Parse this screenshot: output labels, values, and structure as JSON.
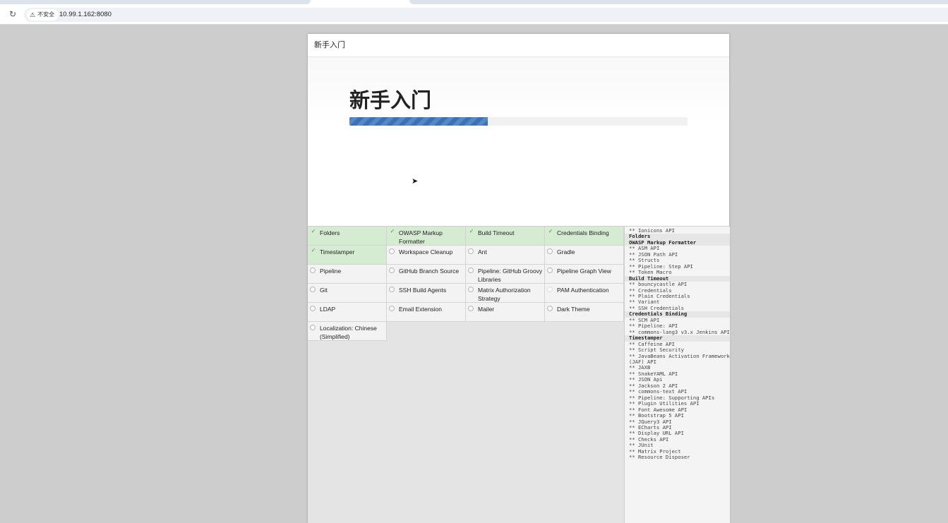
{
  "browser": {
    "security_label": "不安全",
    "url": "10.99.1.162:8080"
  },
  "dialog": {
    "title": "新手入门",
    "heading": "新手入门",
    "progress_fraction": 0.41
  },
  "plugins": [
    {
      "name": "Folders",
      "state": "done"
    },
    {
      "name": "OWASP Markup Formatter",
      "state": "done"
    },
    {
      "name": "Build Timeout",
      "state": "done"
    },
    {
      "name": "Credentials Binding",
      "state": "done"
    },
    {
      "name": "Timestamper",
      "state": "done"
    },
    {
      "name": "Workspace Cleanup",
      "state": "pending"
    },
    {
      "name": "Ant",
      "state": "pending"
    },
    {
      "name": "Gradle",
      "state": "pending"
    },
    {
      "name": "Pipeline",
      "state": "pending"
    },
    {
      "name": "GitHub Branch Source",
      "state": "pending"
    },
    {
      "name": "Pipeline: GitHub Groovy Libraries",
      "state": "pending"
    },
    {
      "name": "Pipeline Graph View",
      "state": "pending"
    },
    {
      "name": "Git",
      "state": "pending"
    },
    {
      "name": "SSH Build Agents",
      "state": "pending"
    },
    {
      "name": "Matrix Authorization Strategy",
      "state": "pending"
    },
    {
      "name": "PAM Authentication",
      "state": "pending-faint"
    },
    {
      "name": "LDAP",
      "state": "pending"
    },
    {
      "name": "Email Extension",
      "state": "pending"
    },
    {
      "name": "Mailer",
      "state": "pending"
    },
    {
      "name": "Dark Theme",
      "state": "pending"
    },
    {
      "name": "Localization: Chinese (Simplified)",
      "state": "pending"
    }
  ],
  "log": [
    {
      "text": "** Ionicons API",
      "head": false
    },
    {
      "text": "Folders",
      "head": true
    },
    {
      "text": "OWASP Markup Formatter",
      "head": true
    },
    {
      "text": "** ASM API",
      "head": false
    },
    {
      "text": "** JSON Path API",
      "head": false
    },
    {
      "text": "** Structs",
      "head": false
    },
    {
      "text": "** Pipeline: Step API",
      "head": false
    },
    {
      "text": "** Token Macro",
      "head": false
    },
    {
      "text": "Build Timeout",
      "head": true
    },
    {
      "text": "** bouncycastle API",
      "head": false
    },
    {
      "text": "** Credentials",
      "head": false
    },
    {
      "text": "** Plain Credentials",
      "head": false
    },
    {
      "text": "** Variant",
      "head": false
    },
    {
      "text": "** SSH Credentials",
      "head": false
    },
    {
      "text": "Credentials Binding",
      "head": true
    },
    {
      "text": "** SCM API",
      "head": false
    },
    {
      "text": "** Pipeline: API",
      "head": false
    },
    {
      "text": "** commons-lang3 v3.x Jenkins API",
      "head": false
    },
    {
      "text": "Timestamper",
      "head": true
    },
    {
      "text": "** Caffeine API",
      "head": false
    },
    {
      "text": "** Script Security",
      "head": false
    },
    {
      "text": "** JavaBeans Activation Framework (JAF) API",
      "head": false
    },
    {
      "text": "** JAXB",
      "head": false
    },
    {
      "text": "** SnakeYAML API",
      "head": false
    },
    {
      "text": "** JSON Api",
      "head": false
    },
    {
      "text": "** Jackson 2 API",
      "head": false
    },
    {
      "text": "** commons-text API",
      "head": false
    },
    {
      "text": "** Pipeline: Supporting APIs",
      "head": false
    },
    {
      "text": "** Plugin Utilities API",
      "head": false
    },
    {
      "text": "** Font Awesome API",
      "head": false
    },
    {
      "text": "** Bootstrap 5 API",
      "head": false
    },
    {
      "text": "** JQuery3 API",
      "head": false
    },
    {
      "text": "** ECharts API",
      "head": false
    },
    {
      "text": "** Display URL API",
      "head": false
    },
    {
      "text": "** Checks API",
      "head": false
    },
    {
      "text": "** JUnit",
      "head": false
    },
    {
      "text": "** Matrix Project",
      "head": false
    },
    {
      "text": "** Resource Disposer",
      "head": false
    }
  ],
  "icons": {
    "reload": "reload-icon",
    "warning": "warning-icon",
    "check": "check-icon",
    "pending": "pending-circle-icon",
    "cursor": "mouse-cursor-icon"
  },
  "colors": {
    "done_bg": "#d6ecd2",
    "progress": "#3a72b5"
  }
}
